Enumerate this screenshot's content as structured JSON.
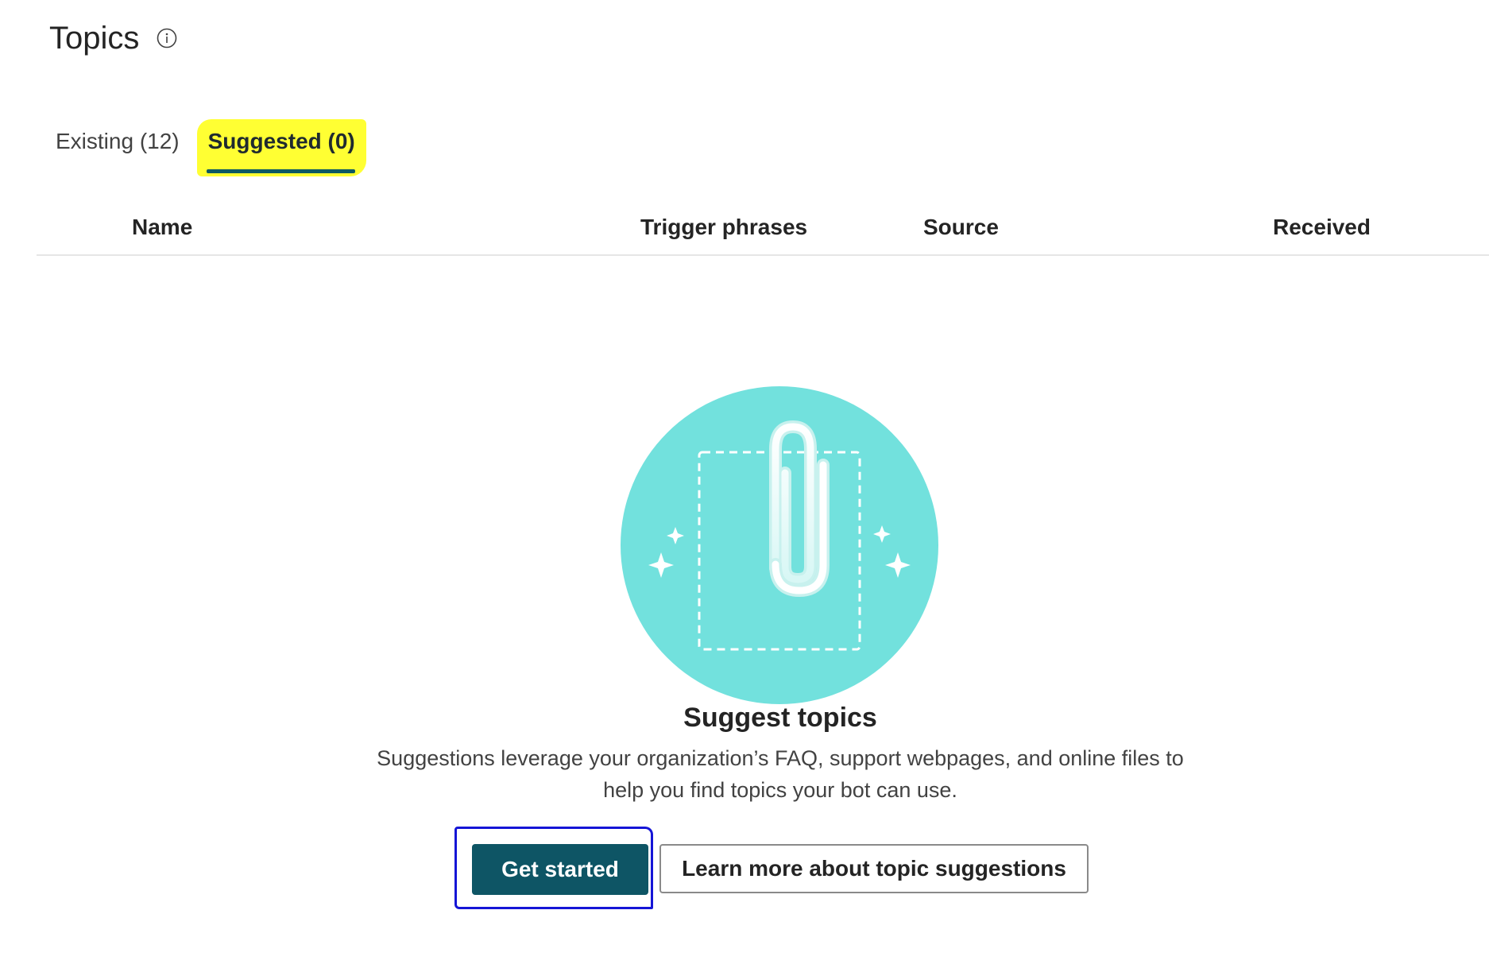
{
  "header": {
    "title": "Topics",
    "info_icon": "info-icon"
  },
  "tabs": [
    {
      "label": "Existing (12)",
      "active": false
    },
    {
      "label": "Suggested (0)",
      "active": true
    }
  ],
  "table": {
    "columns": [
      "Name",
      "Trigger phrases",
      "Source",
      "Received"
    ]
  },
  "empty_state": {
    "illustration": "paperclip-document-icon",
    "title": "Suggest topics",
    "description": "Suggestions leverage your organization’s FAQ, support webpages, and online files to help you find topics your bot can use.",
    "primary_button": "Get started",
    "secondary_button": "Learn more about topic suggestions"
  },
  "colors": {
    "accent": "#0e5565",
    "illustration_circle": "#72e1dd",
    "highlight": "#ffff33",
    "annotation": "#1515d6"
  }
}
